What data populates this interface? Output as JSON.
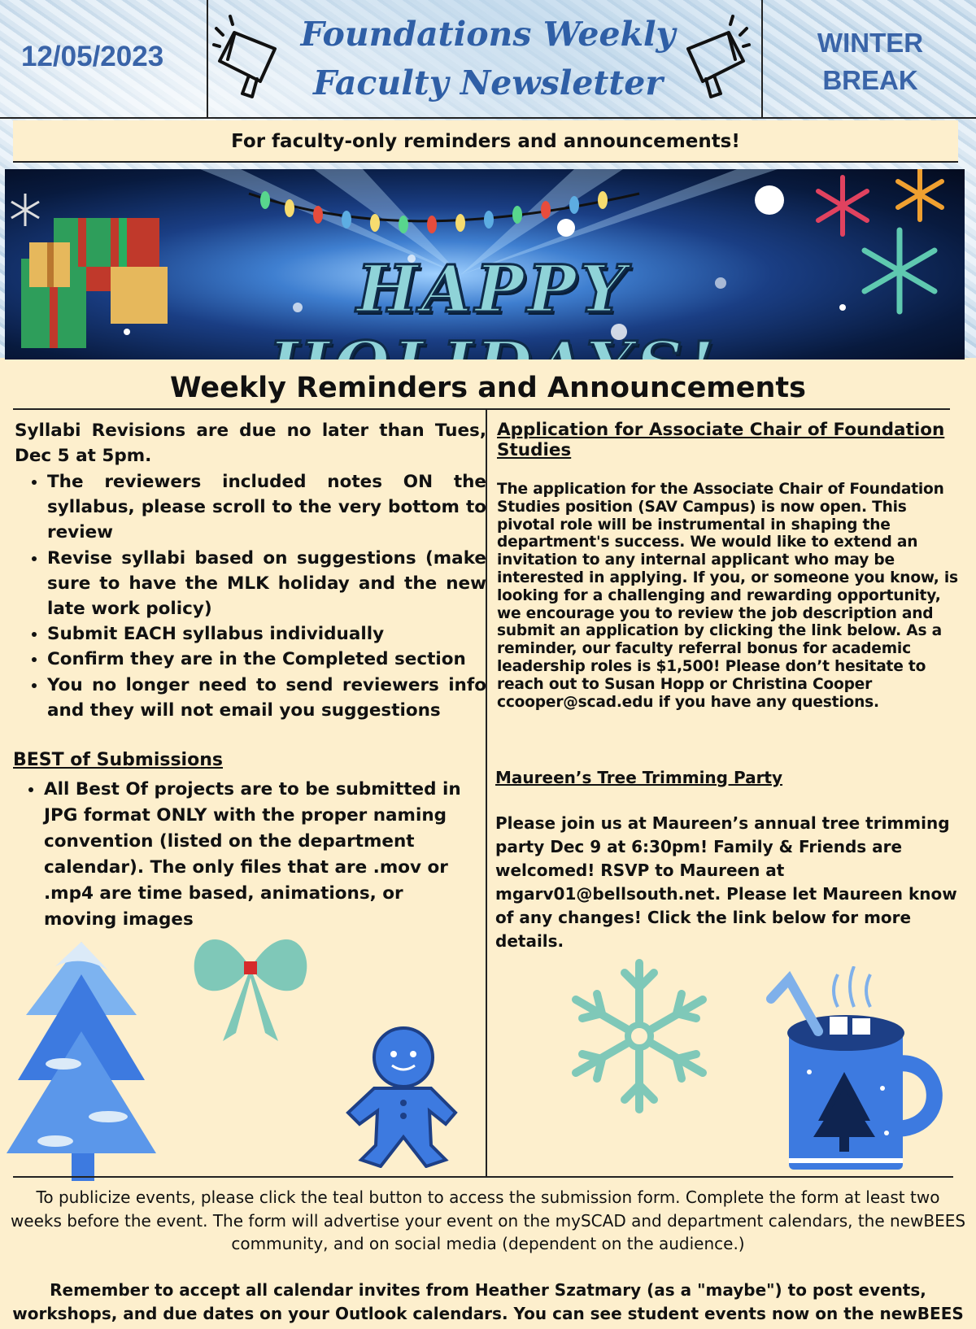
{
  "header": {
    "date": "12/05/2023",
    "title_line1": "Foundations Weekly",
    "title_line2": "Faculty Newsletter",
    "break_line1": "WINTER",
    "break_line2": "BREAK",
    "tagline": "For faculty-only reminders and announcements!"
  },
  "banner": {
    "text": "HAPPY HOLIDAYS!"
  },
  "section_title": "Weekly Reminders and Announcements",
  "left": {
    "lead": "Syllabi Revisions are due no later than Tues, Dec 5 at 5pm.",
    "items": [
      "The reviewers included notes ON the syllabus, please scroll to the very bottom to review",
      "Revise syllabi based on suggestions (make sure to have the MLK holiday and the new late work policy)",
      "Submit EACH syllabus individually",
      "Confirm they are in the Completed section",
      "You no longer need to send reviewers info and they will not email you suggestions"
    ],
    "best_heading": "BEST of Submissions",
    "best_items": [
      "All Best Of projects are to be submitted in JPG format ONLY with the proper naming convention (listed on the department calendar). The only files that are .mov or .mp4 are time based, animations, or moving images"
    ]
  },
  "right": {
    "app_heading": "Application for Associate Chair of Foundation Studies",
    "app_body": "The application for the Associate Chair of Foundation Studies position (SAV Campus) is now open. This pivotal role will be instrumental in shaping the department's success. We would like to extend an invitation to any internal applicant who may be interested in applying. If you, or someone you know, is looking for a challenging and rewarding opportunity, we encourage you to review the job description and submit an application by clicking the link below. As a reminder, our faculty referral bonus for academic leadership roles is $1,500! Please don’t hesitate to reach out to Susan Hopp or Christina Cooper ccooper@scad.edu if you have any questions.",
    "party_heading": "Maureen’s Tree Trimming Party",
    "party_body": "Please join us at Maureen’s annual tree trimming party Dec 9 at 6:30pm! Family & Friends are welcomed! RSVP to Maureen at mgarv01@bellsouth.net. Please let Maureen know of any changes! Click the link below for more details."
  },
  "footer": {
    "publicize": "To publicize events, please click the teal button to access the submission form. Complete the form at least two weeks before the event. The form will advertise your event on the mySCAD and department calendars, the newBEES community, and on social media (dependent on the audience.)",
    "remember": "Remember to accept all calendar invites from Heather Szatmary (as a \"maybe\") to post events, workshops, and due dates on your Outlook calendars. You can see student events now on the newBEES"
  },
  "colors": {
    "page_bg": "#fdefcd",
    "title_blue": "#2f5fa6",
    "accent_teal": "#8fd3d8",
    "icon_blue": "#3d7ae0"
  },
  "icons": [
    "megaphone-icon",
    "christmas-tree-icon",
    "bow-icon",
    "gingerbread-man-icon",
    "snowflake-icon",
    "hot-cocoa-mug-icon"
  ]
}
